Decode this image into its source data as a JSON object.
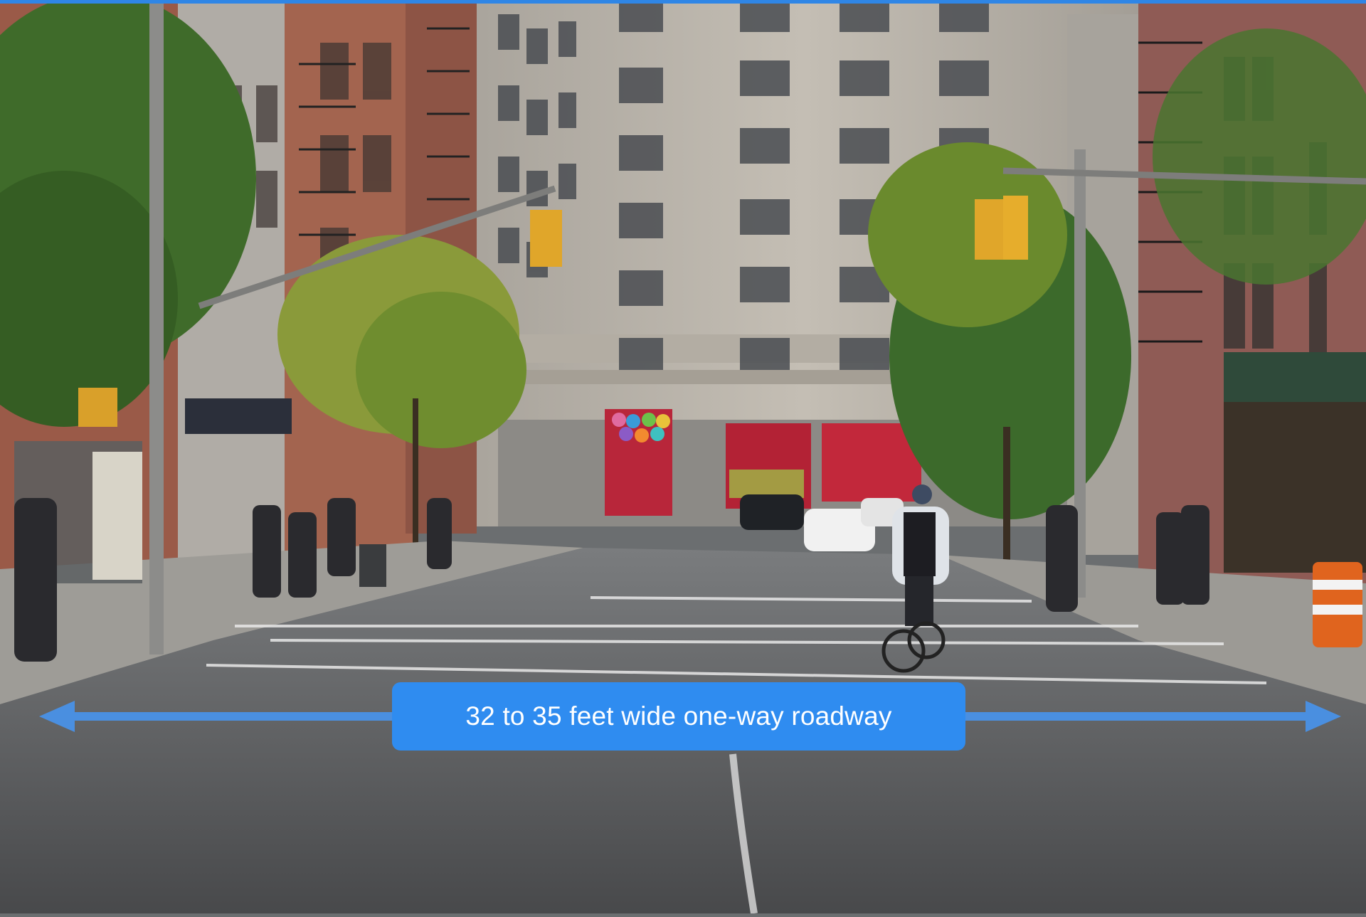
{
  "annotation": {
    "label": "32 to 35 feet wide one-way roadway",
    "arrow_color": "#4a8fe0",
    "box_color": "#2f8cf0"
  },
  "scene": {
    "description_colors": {
      "sky": "#cfd8de",
      "road": "#5b5d5f",
      "building_stone": "#b9b3a9",
      "brick": "#9a5a48",
      "foliage": "#3f6b2a"
    }
  }
}
